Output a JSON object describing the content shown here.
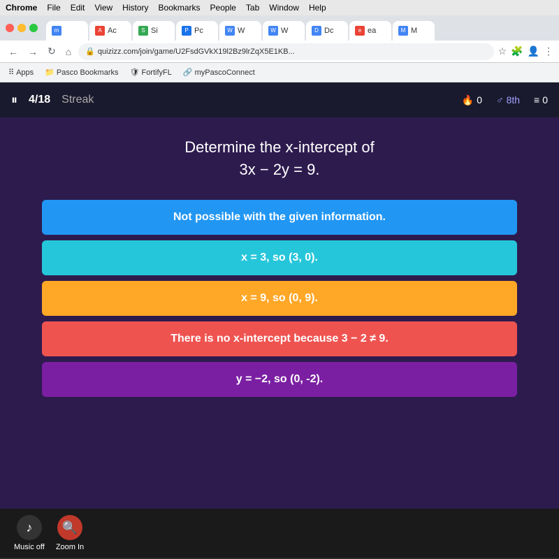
{
  "menubar": {
    "items": [
      "Chrome",
      "File",
      "Edit",
      "View",
      "History",
      "Bookmarks",
      "People",
      "Tab",
      "Window",
      "Help"
    ]
  },
  "chrome": {
    "tabs": [
      {
        "label": "m)",
        "icon": "m"
      },
      {
        "label": "Ac",
        "icon": "A"
      },
      {
        "label": "Si",
        "icon": "S"
      },
      {
        "label": "Pc",
        "icon": "P"
      },
      {
        "label": "W",
        "icon": "W"
      },
      {
        "label": "W",
        "icon": "W"
      },
      {
        "label": "Dc",
        "icon": "D"
      },
      {
        "label": "ea",
        "icon": "e"
      },
      {
        "label": "M",
        "icon": "M"
      }
    ],
    "address": "quizizz.com/join/game/U2FsdGVkX19l2Bz9lrZqX5E1KB...",
    "bookmarks": [
      "Apps",
      "Pasco Bookmarks",
      "FortifyFL",
      "myPascoConnect"
    ]
  },
  "quizizz": {
    "header": {
      "question_number": "4/18",
      "streak_label": "Streak",
      "streak_count": "0",
      "grade": "8th",
      "score": "0"
    },
    "question": {
      "line1": "Determine the x-intercept of",
      "line2": "3x − 2y = 9."
    },
    "answers": [
      {
        "id": "a",
        "text": "Not possible with the given information.",
        "color": "blue"
      },
      {
        "id": "b",
        "text": "x = 3, so (3, 0).",
        "color": "teal"
      },
      {
        "id": "c",
        "text": "x = 9, so (0, 9).",
        "color": "yellow"
      },
      {
        "id": "d",
        "text": "There is no x-intercept because 3 − 2 ≠ 9.",
        "color": "orange"
      },
      {
        "id": "e",
        "text": "y = −2, so (0, -2).",
        "color": "purple"
      }
    ],
    "bottom": {
      "music_label": "Music off",
      "zoom_label": "Zoom In"
    }
  }
}
